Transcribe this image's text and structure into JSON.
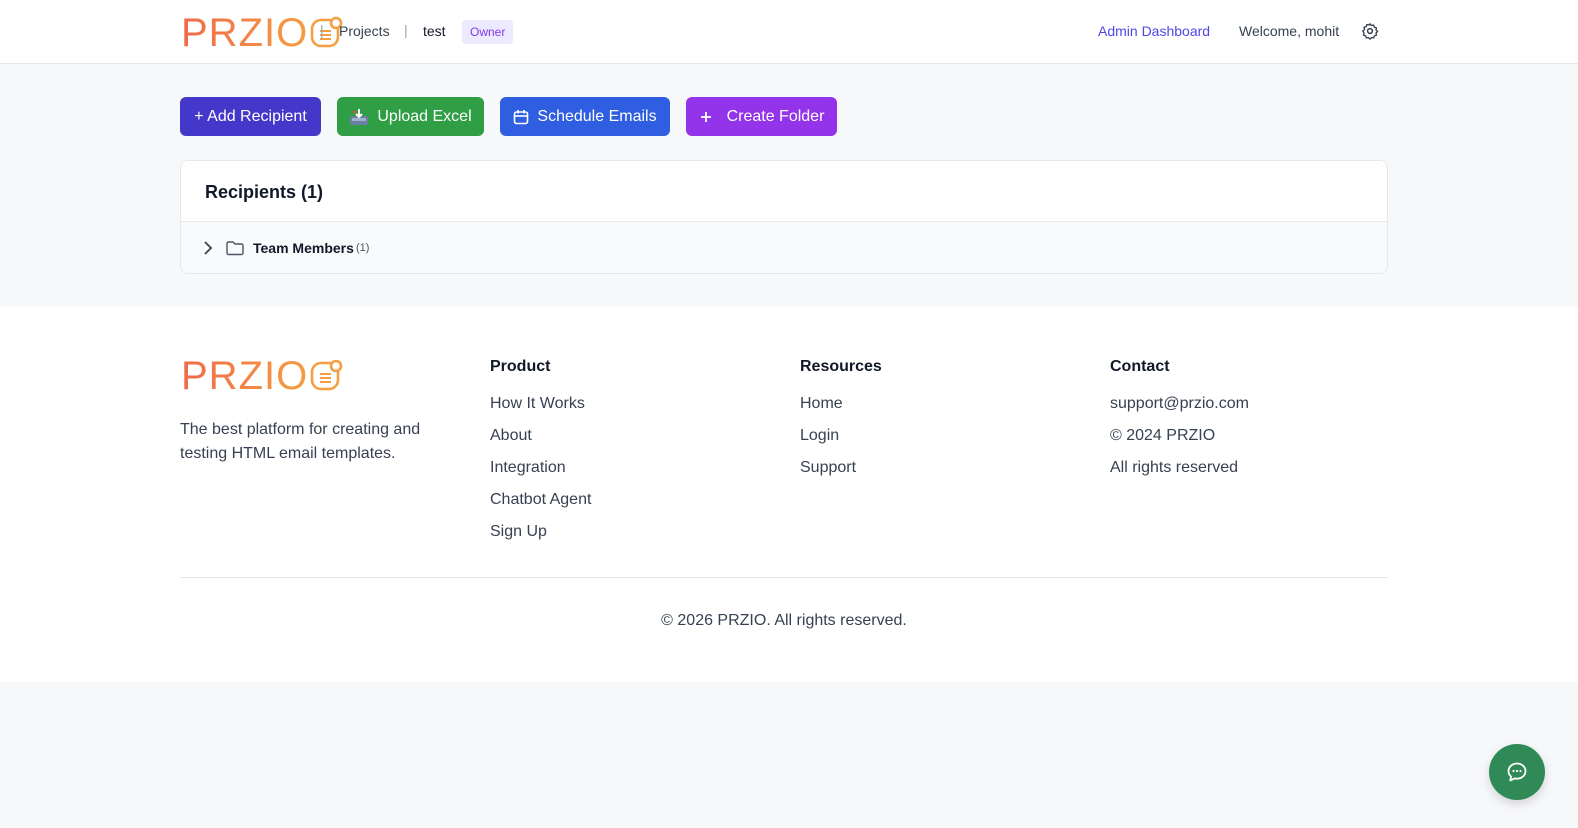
{
  "brand": {
    "name": "PRZIO",
    "logo_colors": [
      "#ef6a4a",
      "#f59e42"
    ]
  },
  "header": {
    "breadcrumbs": [
      "Projects",
      "test"
    ],
    "role_badge": "Owner",
    "admin_link": "Admin Dashboard",
    "welcome": "Welcome, mohit",
    "settings_icon": "gear-icon"
  },
  "actions": {
    "add_recipient": "+ Add Recipient",
    "upload_excel": "Upload Excel",
    "schedule_emails": "Schedule Emails",
    "create_folder": "Create Folder"
  },
  "recipients": {
    "title": "Recipients (1)",
    "folders": [
      {
        "name": "Team Members",
        "count": "(1)"
      }
    ]
  },
  "footer": {
    "tagline": "The best platform for creating and testing HTML email templates.",
    "columns": [
      {
        "heading": "Product",
        "links": [
          "How It Works",
          "About",
          "Integration",
          "Chatbot Agent",
          "Sign Up"
        ]
      },
      {
        "heading": "Resources",
        "links": [
          "Home",
          "Login",
          "Support"
        ]
      },
      {
        "heading": "Contact",
        "links": [
          "support@przio.com",
          "© 2024 PRZIO",
          "All rights reserved"
        ]
      }
    ],
    "copyright": "© 2026 PRZIO. All rights reserved."
  },
  "colors": {
    "add": "#4338ca",
    "upload": "#2f9e44",
    "schedule": "#2f5fe0",
    "folder": "#9333ea",
    "chat": "#2f8a57"
  }
}
